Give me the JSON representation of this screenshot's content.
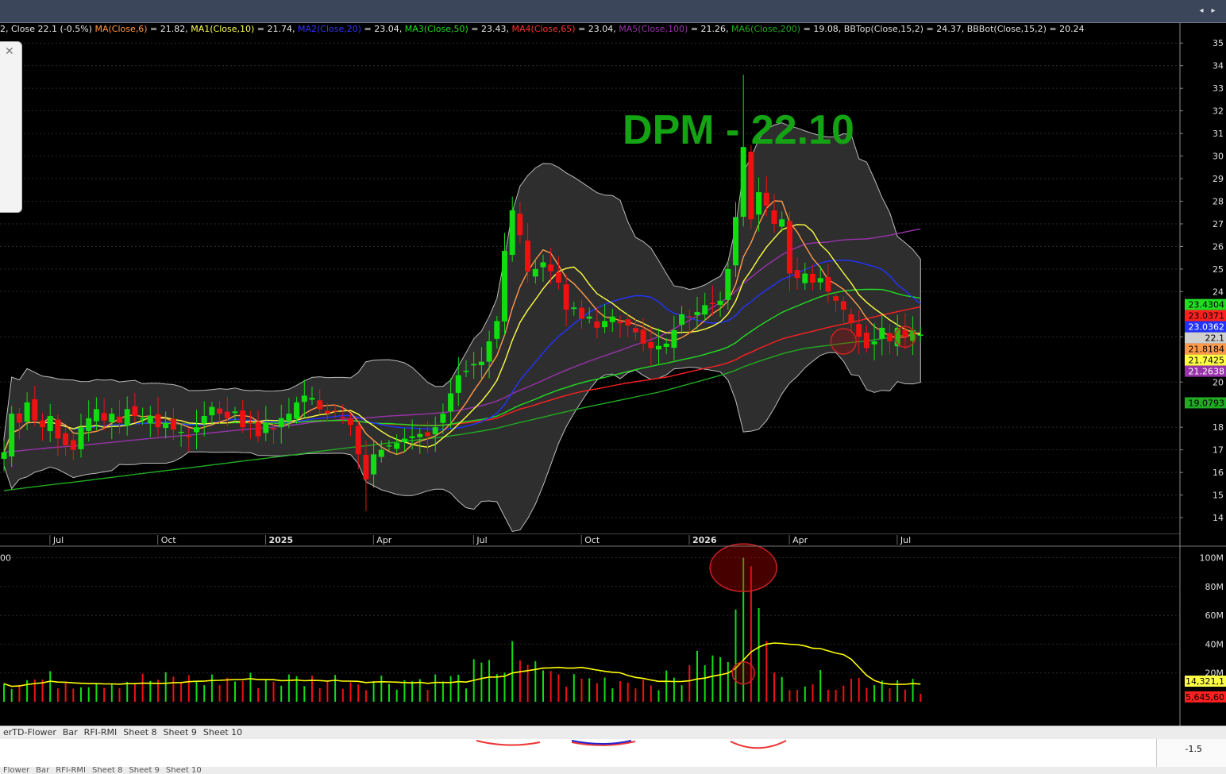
{
  "legend": [
    {
      "text": "2, Close 22.1 (-0.5%)",
      "color": "#e8e8e8"
    },
    {
      "text": "MA(Close,6)",
      "color": "#ff9a4a"
    },
    {
      "text": " = 21.82,",
      "color": "#e8e8e8"
    },
    {
      "text": "MA1(Close,10)",
      "color": "#ffff55"
    },
    {
      "text": " = 21.74,",
      "color": "#e8e8e8"
    },
    {
      "text": "MA2(Close,20)",
      "color": "#3333ff"
    },
    {
      "text": " = 23.04,",
      "color": "#e8e8e8"
    },
    {
      "text": "MA3(Close,50)",
      "color": "#22dd22"
    },
    {
      "text": " = 23.43,",
      "color": "#e8e8e8"
    },
    {
      "text": "MA4(Close,65)",
      "color": "#ff3030"
    },
    {
      "text": " = 23.04,",
      "color": "#e8e8e8"
    },
    {
      "text": "MA5(Close,100)",
      "color": "#9933aa"
    },
    {
      "text": " = 21.26,",
      "color": "#e8e8e8"
    },
    {
      "text": "MA6(Close,200)",
      "color": "#22aa22"
    },
    {
      "text": " = 19.08,",
      "color": "#e8e8e8"
    },
    {
      "text": "BBTop(Close,15,2)",
      "color": "#dddddd"
    },
    {
      "text": " = 24.37,",
      "color": "#e8e8e8"
    },
    {
      "text": "BBBot(Close,15,2)",
      "color": "#dddddd"
    },
    {
      "text": " = 20.24",
      "color": "#e8e8e8"
    }
  ],
  "sheets": [
    "erTD-Flower",
    "Bar",
    "RFI-RMI",
    "Sheet 8",
    "Sheet 9",
    "Sheet 10"
  ],
  "sheets2": [
    "Flower",
    "Bar",
    "RFI-RMI",
    "Sheet 8",
    "Sheet 9",
    "Sheet 10"
  ],
  "lower_pane_value": "-1.5",
  "chart_data": {
    "type": "candlestick",
    "watermark": "DPM - 22.10",
    "price_axis": {
      "ylim": [
        13.3,
        35.5
      ],
      "ticks": [
        14,
        15,
        16,
        17,
        18,
        20,
        22,
        24,
        25,
        26,
        27,
        28,
        29,
        30,
        31,
        32,
        33,
        34,
        35
      ]
    },
    "x_labels": [
      {
        "label": "Jul",
        "bold": false
      },
      {
        "label": "Oct",
        "bold": false
      },
      {
        "label": "2025",
        "bold": true
      },
      {
        "label": "Apr",
        "bold": false
      },
      {
        "label": "Jul",
        "bold": false
      },
      {
        "label": "Oct",
        "bold": false
      },
      {
        "label": "2026",
        "bold": true
      },
      {
        "label": "Apr",
        "bold": false
      },
      {
        "label": "Jul",
        "bold": false
      }
    ],
    "x_label_index": [
      7,
      21,
      35,
      49,
      62,
      76,
      90,
      103,
      117
    ],
    "closes": [
      16.9,
      18.6,
      18.2,
      19.1,
      18.3,
      18.0,
      18.5,
      17.5,
      17.2,
      17.0,
      18.0,
      18.4,
      18.8,
      18.3,
      18.6,
      18.2,
      18.8,
      18.5,
      18.4,
      18.5,
      18.0,
      18.2,
      17.9,
      17.8,
      17.6,
      18.0,
      18.5,
      18.9,
      18.6,
      18.4,
      18.7,
      18.0,
      18.2,
      17.6,
      18.2,
      17.9,
      18.4,
      18.6,
      19.1,
      19.4,
      19.3,
      18.8,
      18.6,
      18.7,
      18.4,
      18.1,
      16.8,
      15.7,
      16.8,
      17.0,
      17.2,
      17.3,
      17.5,
      17.6,
      17.7,
      17.6,
      18.0,
      18.6,
      19.5,
      20.3,
      20.5,
      20.8,
      20.9,
      21.8,
      22.7,
      25.8,
      27.6,
      26.5,
      24.9,
      25.0,
      25.3,
      24.9,
      24.4,
      23.2,
      23.3,
      22.8,
      22.9,
      22.4,
      22.7,
      22.9,
      22.6,
      22.5,
      22.2,
      21.7,
      21.5,
      21.6,
      21.7,
      22.3,
      23.0,
      22.9,
      23.1,
      23.4,
      23.5,
      23.6,
      25.0,
      27.3,
      30.4,
      27.2,
      28.4,
      27.8,
      27.0,
      27.2,
      24.8,
      24.6,
      24.8,
      24.4,
      24.6,
      24.0,
      23.6,
      23.2,
      22.6,
      22.0,
      21.5,
      21.8,
      22.4,
      21.8,
      22.4,
      22.0,
      22.3,
      22.1
    ],
    "volume_axis": {
      "ylim": [
        0,
        103
      ],
      "unit": "M",
      "ticks": [
        20,
        40,
        60,
        80,
        100
      ],
      "tick_labels": [
        "20M",
        "40M",
        "60M",
        "80M",
        "100M"
      ]
    },
    "volume_ma_current": "14,321,1",
    "volume_current": "5,645,60",
    "price_tags": [
      {
        "label": "23.4304",
        "value": 23.43,
        "bg": "#22dd22",
        "fg": "#000"
      },
      {
        "label": "23.0371",
        "value": 23.04,
        "bg": "#ff2020",
        "fg": "#000"
      },
      {
        "label": "23.0362",
        "value": 23.036,
        "bg": "#2233ff",
        "fg": "#fff"
      },
      {
        "label": "22.1",
        "value": 22.1,
        "bg": "#cfcfcf",
        "fg": "#000"
      },
      {
        "label": "21.8184",
        "value": 21.82,
        "bg": "#ff9a4a",
        "fg": "#000"
      },
      {
        "label": "21.7425",
        "value": 21.74,
        "bg": "#ffff44",
        "fg": "#000"
      },
      {
        "label": "21.2638",
        "value": 21.26,
        "bg": "#9933aa",
        "fg": "#fff"
      },
      {
        "label": "19.0793",
        "value": 19.08,
        "bg": "#22aa22",
        "fg": "#000"
      }
    ],
    "colors": {
      "up": "#11dd11",
      "down": "#ee1111",
      "bollinger_fill": "#2e2e2e",
      "grid": "#2a2a2a",
      "volume_ma": "#ffff00",
      "watermark": "#13a313"
    }
  }
}
